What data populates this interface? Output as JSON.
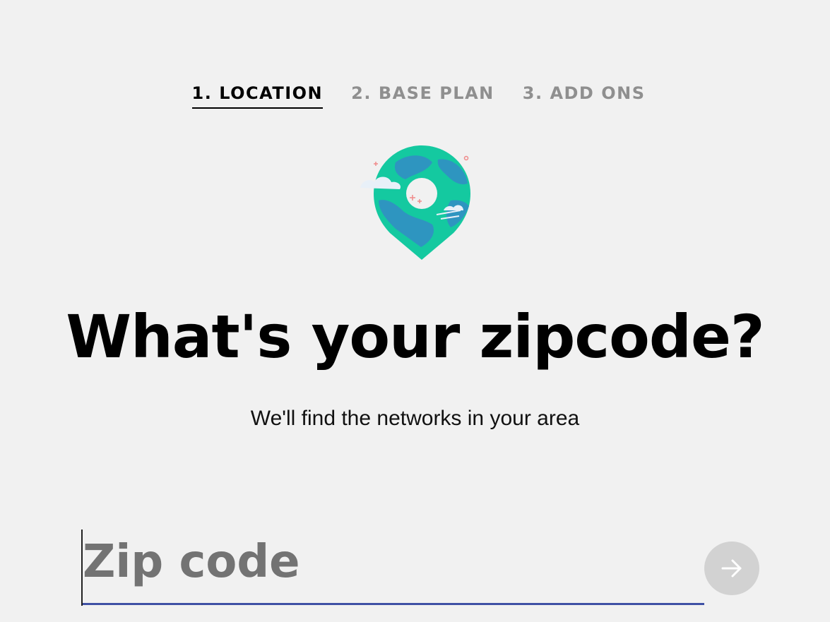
{
  "steps": [
    {
      "label": "1. LOCATION",
      "active": true
    },
    {
      "label": "2. BASE PLAN",
      "active": false
    },
    {
      "label": "3. ADD ONS",
      "active": false
    }
  ],
  "illustration": {
    "icon": "globe-location-pin-icon",
    "colors": {
      "teal": "#14c9a0",
      "blue": "#2e95c0",
      "cloud": "#e8f0f8",
      "accent": "#f08a8a"
    }
  },
  "heading": "What's your zipcode?",
  "subheading": "We'll find the networks in your area",
  "zip": {
    "placeholder": "Zip code",
    "value": ""
  },
  "submit": {
    "icon": "arrow-right-icon"
  },
  "colors": {
    "background": "#f1f1f1",
    "input_underline": "#3f51a5",
    "submit_bg": "#d2d2d2",
    "inactive_step": "#8f8f8f"
  }
}
